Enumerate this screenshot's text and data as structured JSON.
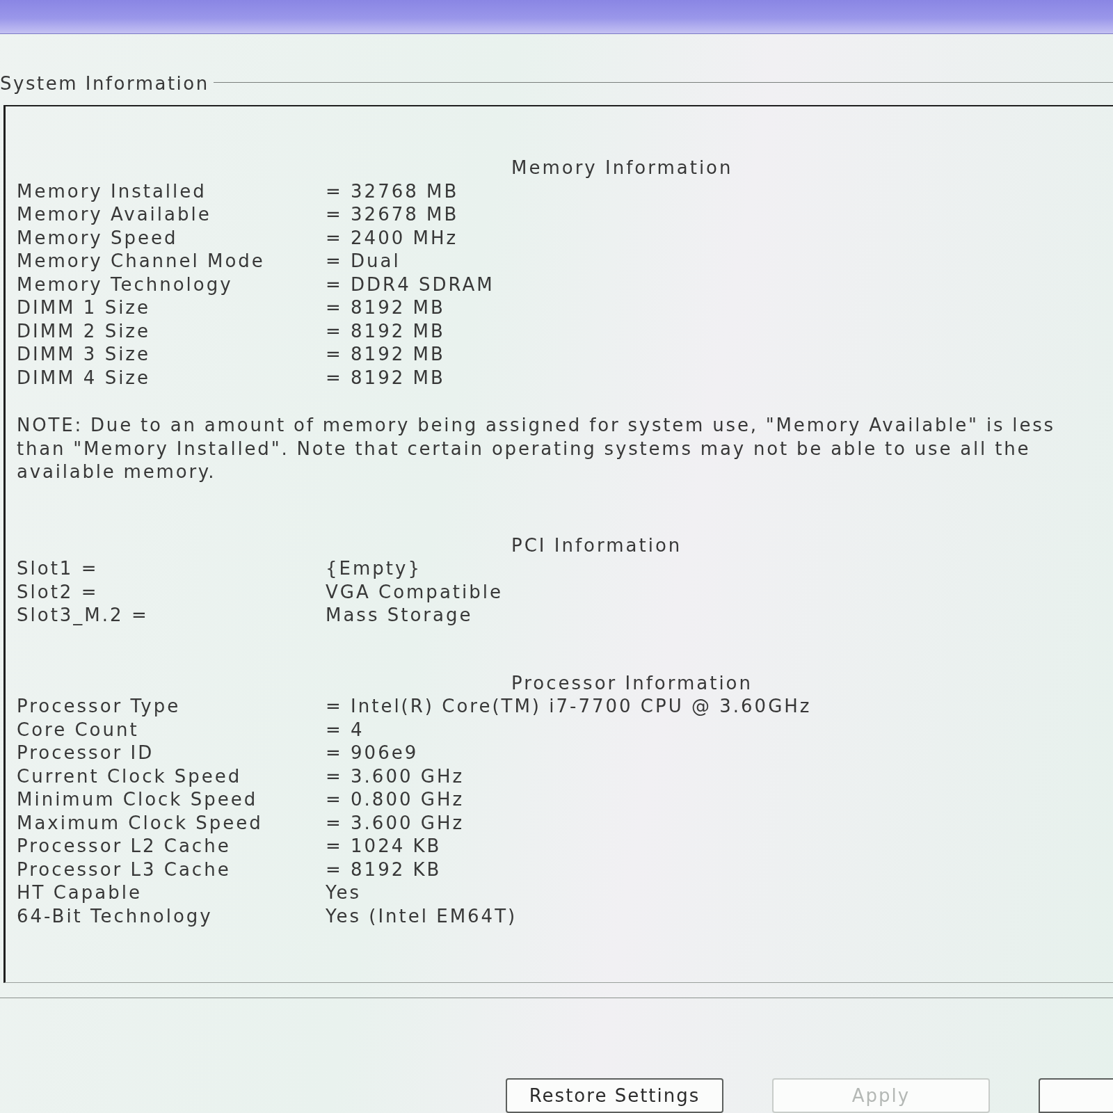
{
  "group_box": {
    "title": "System Information"
  },
  "sections": [
    {
      "heading": "Memory Information",
      "rows": [
        {
          "label": "Memory Installed",
          "value": "= 32768 MB"
        },
        {
          "label": "Memory Available",
          "value": "= 32678 MB"
        },
        {
          "label": "Memory Speed",
          "value": "= 2400 MHz"
        },
        {
          "label": "Memory Channel Mode",
          "value": "= Dual"
        },
        {
          "label": "Memory Technology",
          "value": "= DDR4 SDRAM"
        },
        {
          "label": "DIMM 1 Size",
          "value": "= 8192 MB"
        },
        {
          "label": "DIMM 2 Size",
          "value": "= 8192 MB"
        },
        {
          "label": "DIMM 3 Size",
          "value": "= 8192 MB"
        },
        {
          "label": "DIMM 4 Size",
          "value": "= 8192 MB"
        }
      ],
      "note": "NOTE: Due to an amount of memory being assigned for system use, \"Memory Available\" is less than \"Memory Installed\". Note that certain operating systems may not be able to use all the available memory."
    },
    {
      "heading": "PCI Information",
      "rows": [
        {
          "label": "Slot1 =",
          "value": "{Empty}"
        },
        {
          "label": "Slot2 =",
          "value": "VGA Compatible"
        },
        {
          "label": "Slot3_M.2 =",
          "value": "Mass Storage"
        }
      ]
    },
    {
      "heading": "Processor Information",
      "rows": [
        {
          "label": "Processor Type",
          "value": "= Intel(R) Core(TM) i7-7700 CPU @ 3.60GHz"
        },
        {
          "label": "Core Count",
          "value": "= 4"
        },
        {
          "label": "Processor ID",
          "value": "= 906e9"
        },
        {
          "label": "Current Clock Speed",
          "value": "= 3.600 GHz"
        },
        {
          "label": "Minimum Clock Speed",
          "value": "= 0.800 GHz"
        },
        {
          "label": "Maximum Clock Speed",
          "value": "= 3.600 GHz"
        },
        {
          "label": "Processor L2 Cache",
          "value": "= 1024 KB"
        },
        {
          "label": "Processor L3 Cache",
          "value": "= 8192 KB"
        },
        {
          "label": "HT Capable",
          "value": "Yes"
        },
        {
          "label": "64-Bit Technology",
          "value": "Yes (Intel EM64T)"
        }
      ]
    }
  ],
  "buttons": [
    {
      "label": "Restore Settings",
      "disabled": false
    },
    {
      "label": "Apply",
      "disabled": true
    },
    {
      "disabled": false
    }
  ]
}
